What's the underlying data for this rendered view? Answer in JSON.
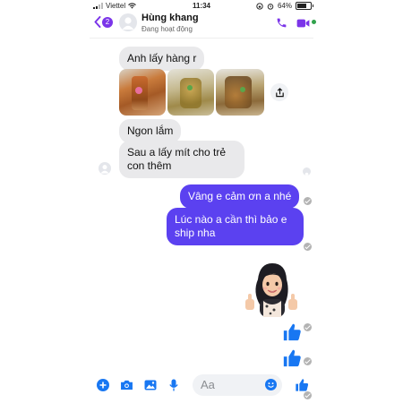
{
  "status_bar": {
    "carrier": "Viettel",
    "time": "11:34",
    "battery": "64%"
  },
  "header": {
    "back_count": "2",
    "contact_name": "Hùng khang",
    "contact_status": "Đang hoạt động",
    "icons": [
      "chevron-left-icon",
      "phone-icon",
      "video-icon"
    ],
    "accent_color": "#7b35e9",
    "online_color": "#31a24c"
  },
  "messages": {
    "incoming_1": "Anh lấy hàng r",
    "incoming_2": "Ngon lắm",
    "incoming_3": "Sau a lấy mít cho trẻ con thêm",
    "outgoing_1": "Vâng e cảm ơn a nhé",
    "outgoing_2": "Lúc nào a cần thì bảo e ship nha",
    "outgoing_bubble_color": "#5b41f0",
    "incoming_bubble_color": "#e9e9eb"
  },
  "photos": [
    "dried-jackfruit-photo-1",
    "dried-jackfruit-photo-2",
    "dried-jackfruit-photo-3"
  ],
  "composer": {
    "placeholder": "Aa",
    "icons": [
      "plus-icon",
      "camera-icon",
      "gallery-icon",
      "mic-icon",
      "emoji-icon",
      "like-icon"
    ]
  }
}
